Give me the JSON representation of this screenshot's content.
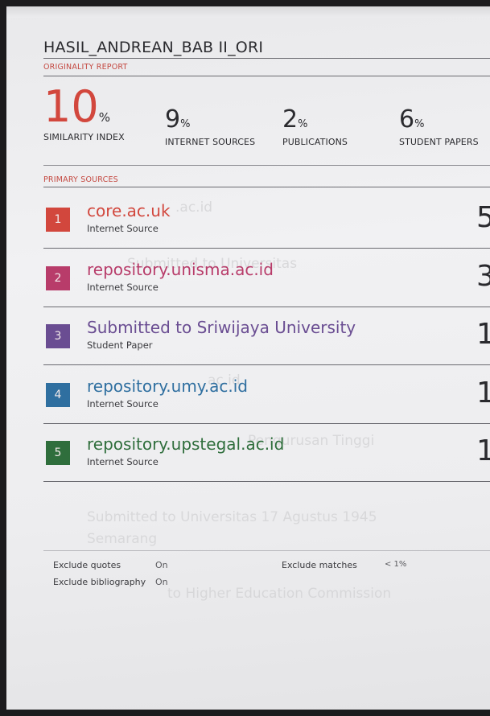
{
  "report": {
    "title": "HASIL_ANDREAN_BAB II_ORI",
    "originality_label": "ORIGINALITY REPORT",
    "primary_sources_label": "PRIMARY SOURCES"
  },
  "stats": [
    {
      "value": "10",
      "unit": "%",
      "label": "SIMILARITY INDEX"
    },
    {
      "value": "9",
      "unit": "%",
      "label": "INTERNET SOURCES"
    },
    {
      "value": "2",
      "unit": "%",
      "label": "PUBLICATIONS"
    },
    {
      "value": "6",
      "unit": "%",
      "label": "STUDENT PAPERS"
    }
  ],
  "sources": [
    {
      "rank": "1",
      "name": "core.ac.uk",
      "type": "Internet Source",
      "percent": "5",
      "color": "#d2473d"
    },
    {
      "rank": "2",
      "name": "repository.unisma.ac.id",
      "type": "Internet Source",
      "percent": "3",
      "color": "#b83c6a"
    },
    {
      "rank": "3",
      "name": "Submitted to Sriwijaya University",
      "type": "Student Paper",
      "percent": "1",
      "color": "#6a4d92"
    },
    {
      "rank": "4",
      "name": "repository.umy.ac.id",
      "type": "Internet Source",
      "percent": "1",
      "color": "#2f6fa0"
    },
    {
      "rank": "5",
      "name": "repository.upstegal.ac.id",
      "type": "Internet Source",
      "percent": "1",
      "color": "#2f6e3c"
    }
  ],
  "footer": {
    "exclude_quotes_label": "Exclude quotes",
    "exclude_quotes_value": "On",
    "exclude_bibliography_label": "Exclude bibliography",
    "exclude_bibliography_value": "On",
    "exclude_matches_label": "Exclude matches",
    "exclude_matches_value": "< 1%"
  }
}
